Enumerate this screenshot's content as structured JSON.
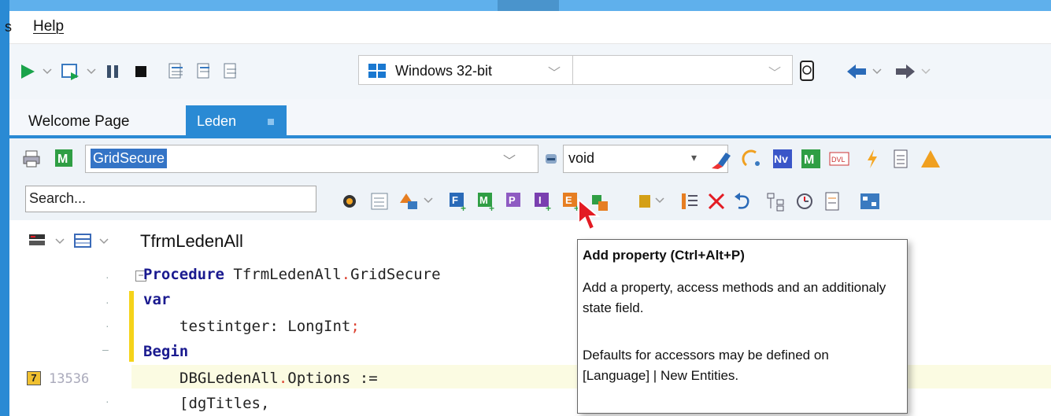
{
  "menubar": {
    "partial_label": "s",
    "help_label": "Help"
  },
  "toolbar": {
    "platform": "Windows 32-bit",
    "empty_combo": ""
  },
  "tabs": [
    {
      "label": "Welcome Page"
    },
    {
      "label": "Leden"
    }
  ],
  "editor_toolbar": {
    "method_value": "GridSecure",
    "return_type_value": "void",
    "search_placeholder": "Search..."
  },
  "editor": {
    "class_name": "TfrmLedenAll",
    "line_number": "13536",
    "bookmark": "7",
    "lines": {
      "proc_kw": "Procedure",
      "proc_name": " TfrmLedenAll",
      "proc_rest": "GridSecure",
      "var_kw": "var",
      "decl": "testintger: LongInt",
      "begin_kw": "Begin",
      "assign_left": "DBGLedenAll",
      "assign_right": "Options :=",
      "titles": "[dgTitles,"
    }
  },
  "tooltip": {
    "title": "Add property (Ctrl+Alt+P)",
    "body": "Add a property, access methods and an additionaly state field.",
    "body2": "Defaults for accessors may be defined on [Language] | New Entities."
  },
  "icons": [
    "run-icon",
    "dropdown-chevron-icon",
    "run-without-debug-icon",
    "pause-icon",
    "stop-icon",
    "step-icon",
    "cloud-icon",
    "back-arrow-icon",
    "forward-arrow-icon",
    "printer-icon",
    "method-icon",
    "eraser-icon",
    "add-property-icon",
    "delete-icon",
    "undo-icon"
  ],
  "colors": {
    "accent": "#2a8ad4",
    "selection": "#3474c6",
    "cursor": "#e31b23"
  }
}
